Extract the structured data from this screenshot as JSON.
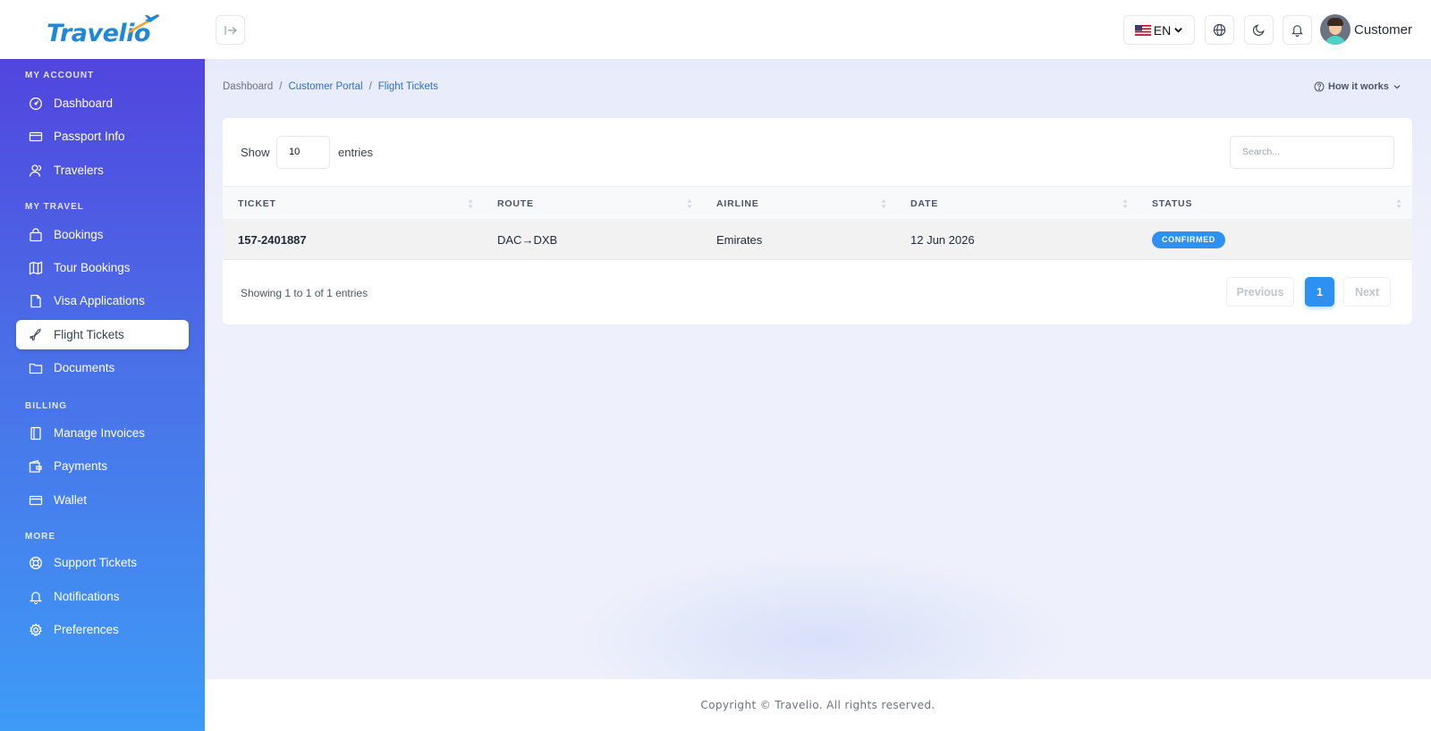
{
  "brand": {
    "name": "Travelio"
  },
  "topbar": {
    "language": "EN",
    "user_name": "Customer"
  },
  "sidebar": {
    "sections": [
      {
        "title": "MY ACCOUNT"
      },
      {
        "title": "MY TRAVEL"
      },
      {
        "title": "BILLING"
      },
      {
        "title": "MORE"
      }
    ],
    "items": [
      {
        "label": "Dashboard",
        "icon": "gauge-icon"
      },
      {
        "label": "Passport Info",
        "icon": "card-icon"
      },
      {
        "label": "Travelers",
        "icon": "users-icon"
      },
      {
        "label": "Bookings",
        "icon": "bag-icon"
      },
      {
        "label": "Tour Bookings",
        "icon": "map-icon"
      },
      {
        "label": "Visa Applications",
        "icon": "file-icon"
      },
      {
        "label": "Flight Tickets",
        "icon": "plane-icon",
        "active": true
      },
      {
        "label": "Documents",
        "icon": "folder-icon"
      },
      {
        "label": "Manage Invoices",
        "icon": "receipt-icon"
      },
      {
        "label": "Payments",
        "icon": "wallet-icon"
      },
      {
        "label": "Wallet",
        "icon": "credit-card-icon"
      },
      {
        "label": "Support Tickets",
        "icon": "lifebuoy-icon"
      },
      {
        "label": "Notifications",
        "icon": "bell-icon"
      },
      {
        "label": "Preferences",
        "icon": "gear-icon"
      }
    ]
  },
  "breadcrumb": {
    "items": [
      "Dashboard",
      "Customer Portal",
      "Flight Tickets"
    ],
    "separator": "/"
  },
  "help": {
    "label": "How it works"
  },
  "table_controls": {
    "show_label": "Show",
    "entries_value": "10",
    "entries_label": "entries",
    "search_placeholder": "Search..."
  },
  "table": {
    "columns": [
      "TICKET",
      "ROUTE",
      "AIRLINE",
      "DATE",
      "STATUS"
    ],
    "rows": [
      {
        "ticket": "157-2401887",
        "route": "DAC→DXB",
        "airline": "Emirates",
        "date": "12 Jun 2026",
        "status": "CONFIRMED"
      }
    ]
  },
  "pagination": {
    "summary": "Showing 1 to 1 of 1 entries",
    "previous": "Previous",
    "current_page": "1",
    "next": "Next"
  },
  "footer": {
    "copyright": "Copyright © Travelio. All rights reserved."
  },
  "colors": {
    "accent": "#2e90f0",
    "sidebar_top": "#5145de",
    "sidebar_bottom": "#3e9bf6",
    "link": "#2f6fc9"
  }
}
